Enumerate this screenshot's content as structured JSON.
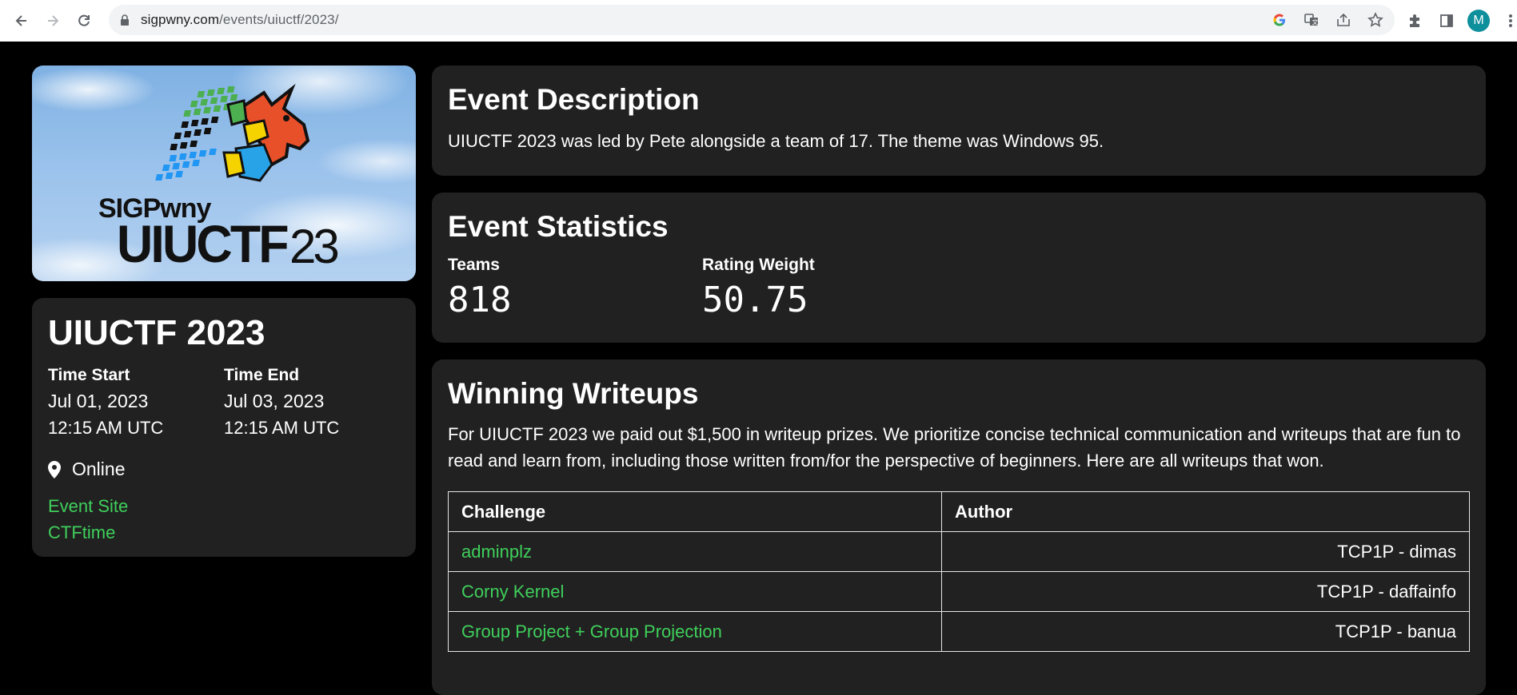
{
  "browser": {
    "url_domain": "sigpwny.com",
    "url_path": "/events/uiuctf/2023/",
    "avatar_initial": "M"
  },
  "logo": {
    "org": "SIGPwny",
    "name": "UIUCTF",
    "year": "23"
  },
  "event": {
    "title": "UIUCTF 2023",
    "time_start_label": "Time Start",
    "time_start_date": "Jul 01, 2023",
    "time_start_time": "12:15 AM UTC",
    "time_end_label": "Time End",
    "time_end_date": "Jul 03, 2023",
    "time_end_time": "12:15 AM UTC",
    "location": "Online",
    "links": [
      "Event Site",
      "CTFtime"
    ]
  },
  "description": {
    "heading": "Event Description",
    "text": "UIUCTF 2023 was led by Pete alongside a team of 17. The theme was Windows 95."
  },
  "statistics": {
    "heading": "Event Statistics",
    "teams_label": "Teams",
    "teams_value": "818",
    "rating_label": "Rating Weight",
    "rating_value": "50.75"
  },
  "writeups": {
    "heading": "Winning Writeups",
    "intro": "For UIUCTF 2023 we paid out $1,500 in writeup prizes. We prioritize concise technical communication and writeups that are fun to read and learn from, including those written from/for the perspective of beginners. Here are all writeups that won.",
    "columns": [
      "Challenge",
      "Author"
    ],
    "rows": [
      {
        "challenge": "adminplz",
        "author": "TCP1P - dimas"
      },
      {
        "challenge": "Corny Kernel",
        "author": "TCP1P - daffainfo"
      },
      {
        "challenge": "Group Project + Group Projection",
        "author": "TCP1P - banua"
      }
    ]
  },
  "colors": {
    "background": "#000000",
    "card": "#212121",
    "link_green": "#3fd05b"
  }
}
